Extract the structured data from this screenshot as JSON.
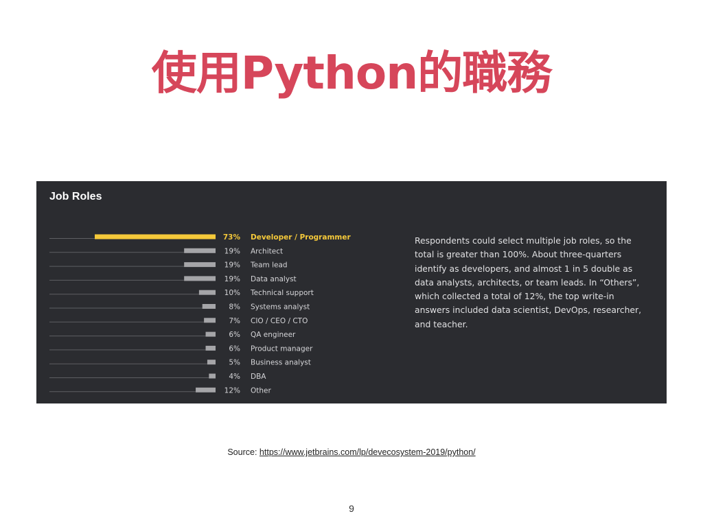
{
  "slide": {
    "title": "使用Python的職務",
    "source_label": "Source:",
    "source_url": "https://www.jetbrains.com/lp/devecosystem-2019/python/",
    "page_number": "9"
  },
  "panel": {
    "title": "Job Roles",
    "description": "Respondents could select multiple job roles, so the total is greater than 100%. About three-quarters identify as developers, and almost 1 in 5 double as data analysts, architects, or team leads. In “Others”, which collected a total of 12%, the top write-in answers included data scientist, DevOps, researcher, and teacher."
  },
  "colors": {
    "highlight": "#f5c93a",
    "bar": "#a5a5a8",
    "track": "#5e5f63",
    "label": "#d5d5d8",
    "panel_background": "#2b2c30",
    "title": "#d6465a"
  },
  "chart_data": {
    "type": "bar",
    "title": "Job Roles",
    "orientation": "horizontal",
    "unit": "%",
    "categories": [
      "Developer / Programmer",
      "Architect",
      "Team lead",
      "Data analyst",
      "Technical support",
      "Systems analyst",
      "CIO / CEO / CTO",
      "QA engineer",
      "Product manager",
      "Business analyst",
      "DBA",
      "Other"
    ],
    "values": [
      73,
      19,
      19,
      19,
      10,
      8,
      7,
      6,
      6,
      5,
      4,
      12
    ],
    "value_labels": [
      "73%",
      "19%",
      "19%",
      "19%",
      "10%",
      "8%",
      "7%",
      "6%",
      "6%",
      "5%",
      "4%",
      "12%"
    ],
    "highlighted_index": 0,
    "xlim": [
      0,
      100
    ],
    "grid": false,
    "legend": "none"
  }
}
